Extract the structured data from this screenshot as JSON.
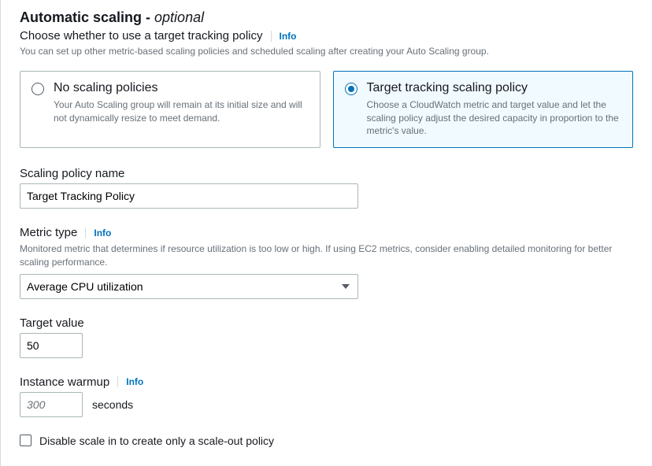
{
  "header": {
    "title_main": "Automatic scaling - ",
    "title_optional": "optional",
    "subtitle": "Choose whether to use a target tracking policy",
    "info_label": "Info",
    "hint": "You can set up other metric-based scaling policies and scheduled scaling after creating your Auto Scaling group."
  },
  "radio_options": {
    "no_scaling": {
      "title": "No scaling policies",
      "desc": "Your Auto Scaling group will remain at its initial size and will not dynamically resize to meet demand."
    },
    "target_tracking": {
      "title": "Target tracking scaling policy",
      "desc": "Choose a CloudWatch metric and target value and let the scaling policy adjust the desired capacity in proportion to the metric's value."
    }
  },
  "policy_name": {
    "label": "Scaling policy name",
    "value": "Target Tracking Policy"
  },
  "metric_type": {
    "label": "Metric type",
    "info_label": "Info",
    "hint": "Monitored metric that determines if resource utilization is too low or high. If using EC2 metrics, consider enabling detailed monitoring for better scaling performance.",
    "selected": "Average CPU utilization"
  },
  "target_value": {
    "label": "Target value",
    "value": "50"
  },
  "instance_warmup": {
    "label": "Instance warmup",
    "info_label": "Info",
    "placeholder": "300",
    "unit": "seconds"
  },
  "disable_scale_in": {
    "label": "Disable scale in to create only a scale-out policy"
  }
}
